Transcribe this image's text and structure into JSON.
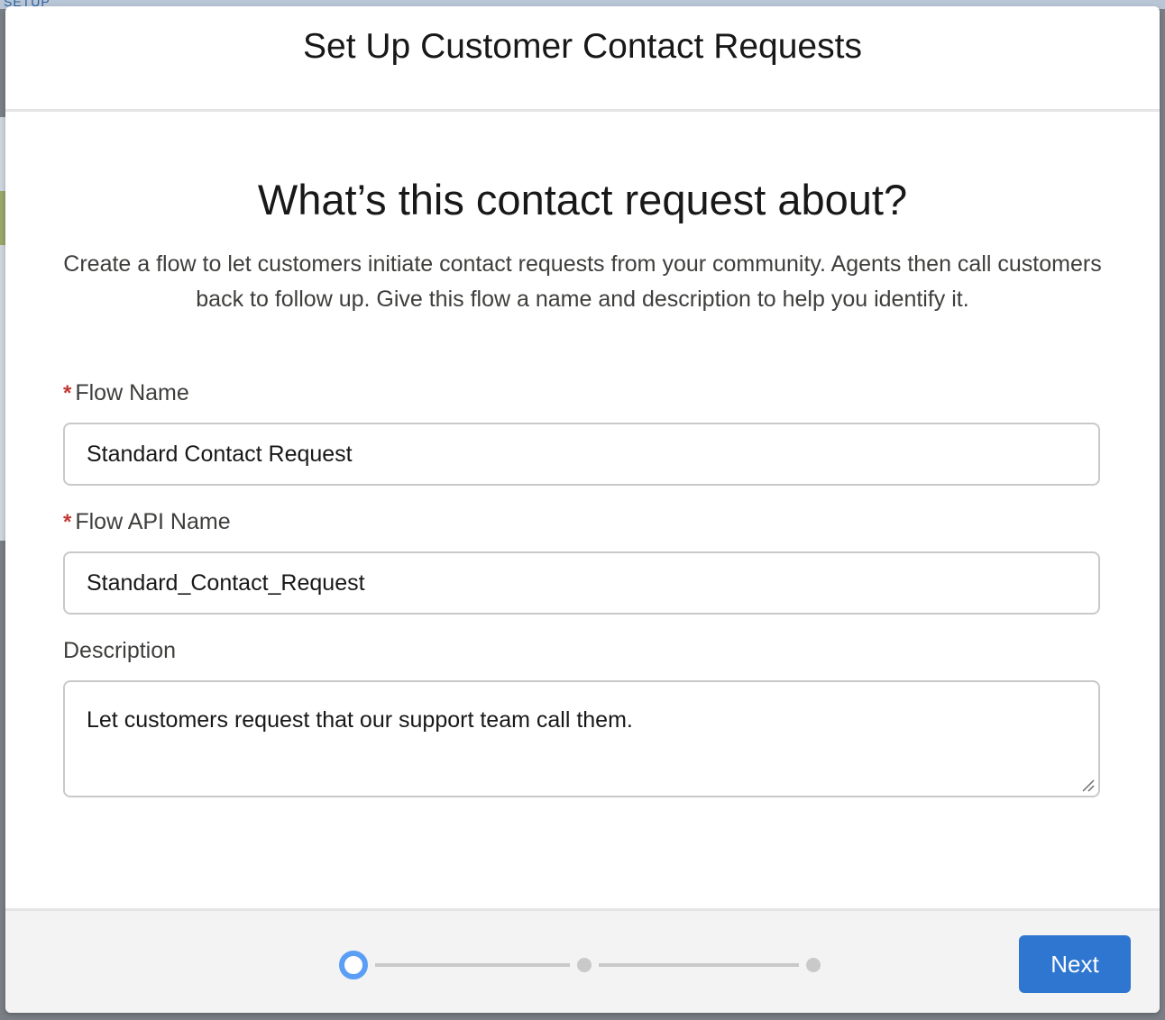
{
  "background": {
    "partial_label": "SETUP"
  },
  "modal": {
    "title": "Set Up Customer Contact Requests",
    "heading": "What’s this contact request about?",
    "intro": "Create a flow to let customers initiate contact requests from your community. Agents then call customers back to follow up. Give this flow a name and description to help you identify it.",
    "fields": {
      "flow_name": {
        "required_marker": "*",
        "label": "Flow Name",
        "value": "Standard Contact Request"
      },
      "flow_api_name": {
        "required_marker": "*",
        "label": "Flow API Name",
        "value": "Standard_Contact_Request"
      },
      "description": {
        "label": "Description",
        "value": "Let customers request that our support team call them."
      }
    }
  },
  "footer": {
    "progress": {
      "current_step": 1,
      "total_steps": 3
    },
    "next_label": "Next"
  },
  "colors": {
    "primary_button": "#2e76d0",
    "current_step_ring": "#5a9ef5",
    "required_marker": "#c23934"
  }
}
